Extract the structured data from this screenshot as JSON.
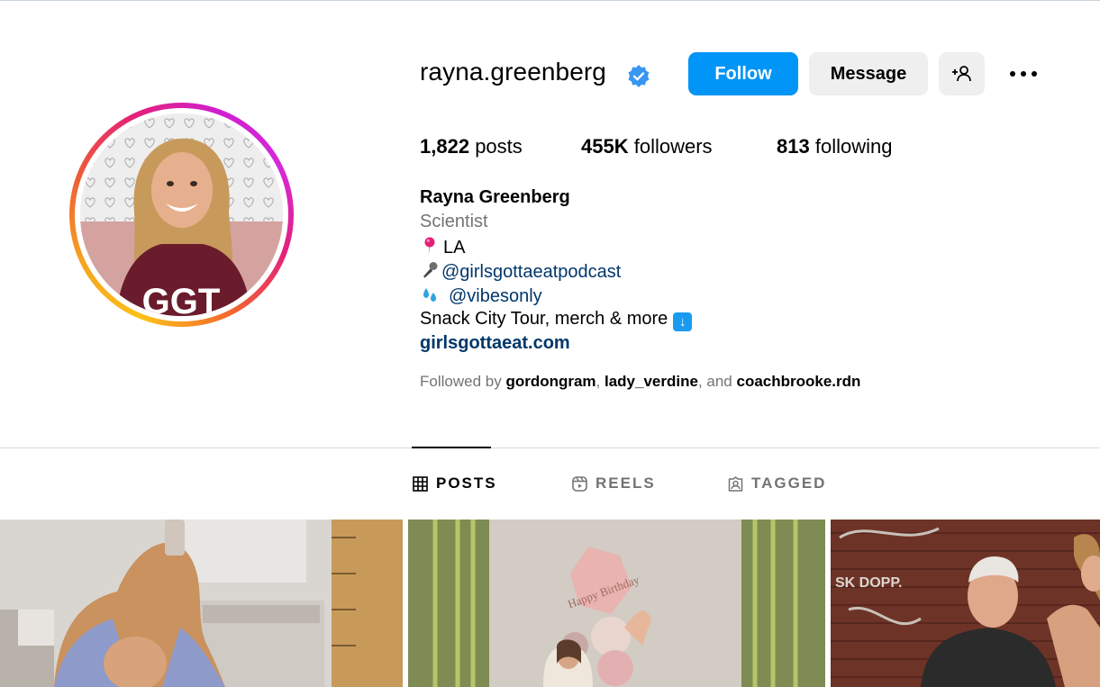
{
  "profile": {
    "username": "rayna.greenberg",
    "verified": true,
    "avatar_alt": "profile-photo",
    "avatar_text": "GGT"
  },
  "actions": {
    "follow_label": "Follow",
    "message_label": "Message"
  },
  "stats": {
    "posts_count": "1,822",
    "posts_label": "posts",
    "followers_count": "455K",
    "followers_label": "followers",
    "following_count": "813",
    "following_label": "following"
  },
  "bio": {
    "full_name": "Rayna Greenberg",
    "category": "Scientist",
    "location": "LA",
    "podcast_handle": "@girlsgottaeatpodcast",
    "second_handle": "@vibesonly",
    "tour_text": "Snack City Tour, merch & more",
    "website": "girlsgottaeat.com"
  },
  "followed_by": {
    "prefix": "Followed by ",
    "user1": "gordongram",
    "sep1": ", ",
    "user2": "lady_verdine",
    "sep2": ", and ",
    "user3": "coachbrooke.rdn"
  },
  "tabs": [
    {
      "label": "POSTS",
      "icon": "grid-icon",
      "active": true
    },
    {
      "label": "REELS",
      "icon": "reels-icon",
      "active": false
    },
    {
      "label": "TAGGED",
      "icon": "tagged-icon",
      "active": false
    }
  ],
  "posts": [
    {
      "description": "mirror selfie in bathroom"
    },
    {
      "description": "birthday balloons celebration"
    },
    {
      "description": "group photo by brick wall"
    }
  ],
  "colors": {
    "follow_blue": "#0095f6",
    "link_blue": "#00376b",
    "secondary_gray": "#737373",
    "button_gray": "#efefef"
  }
}
